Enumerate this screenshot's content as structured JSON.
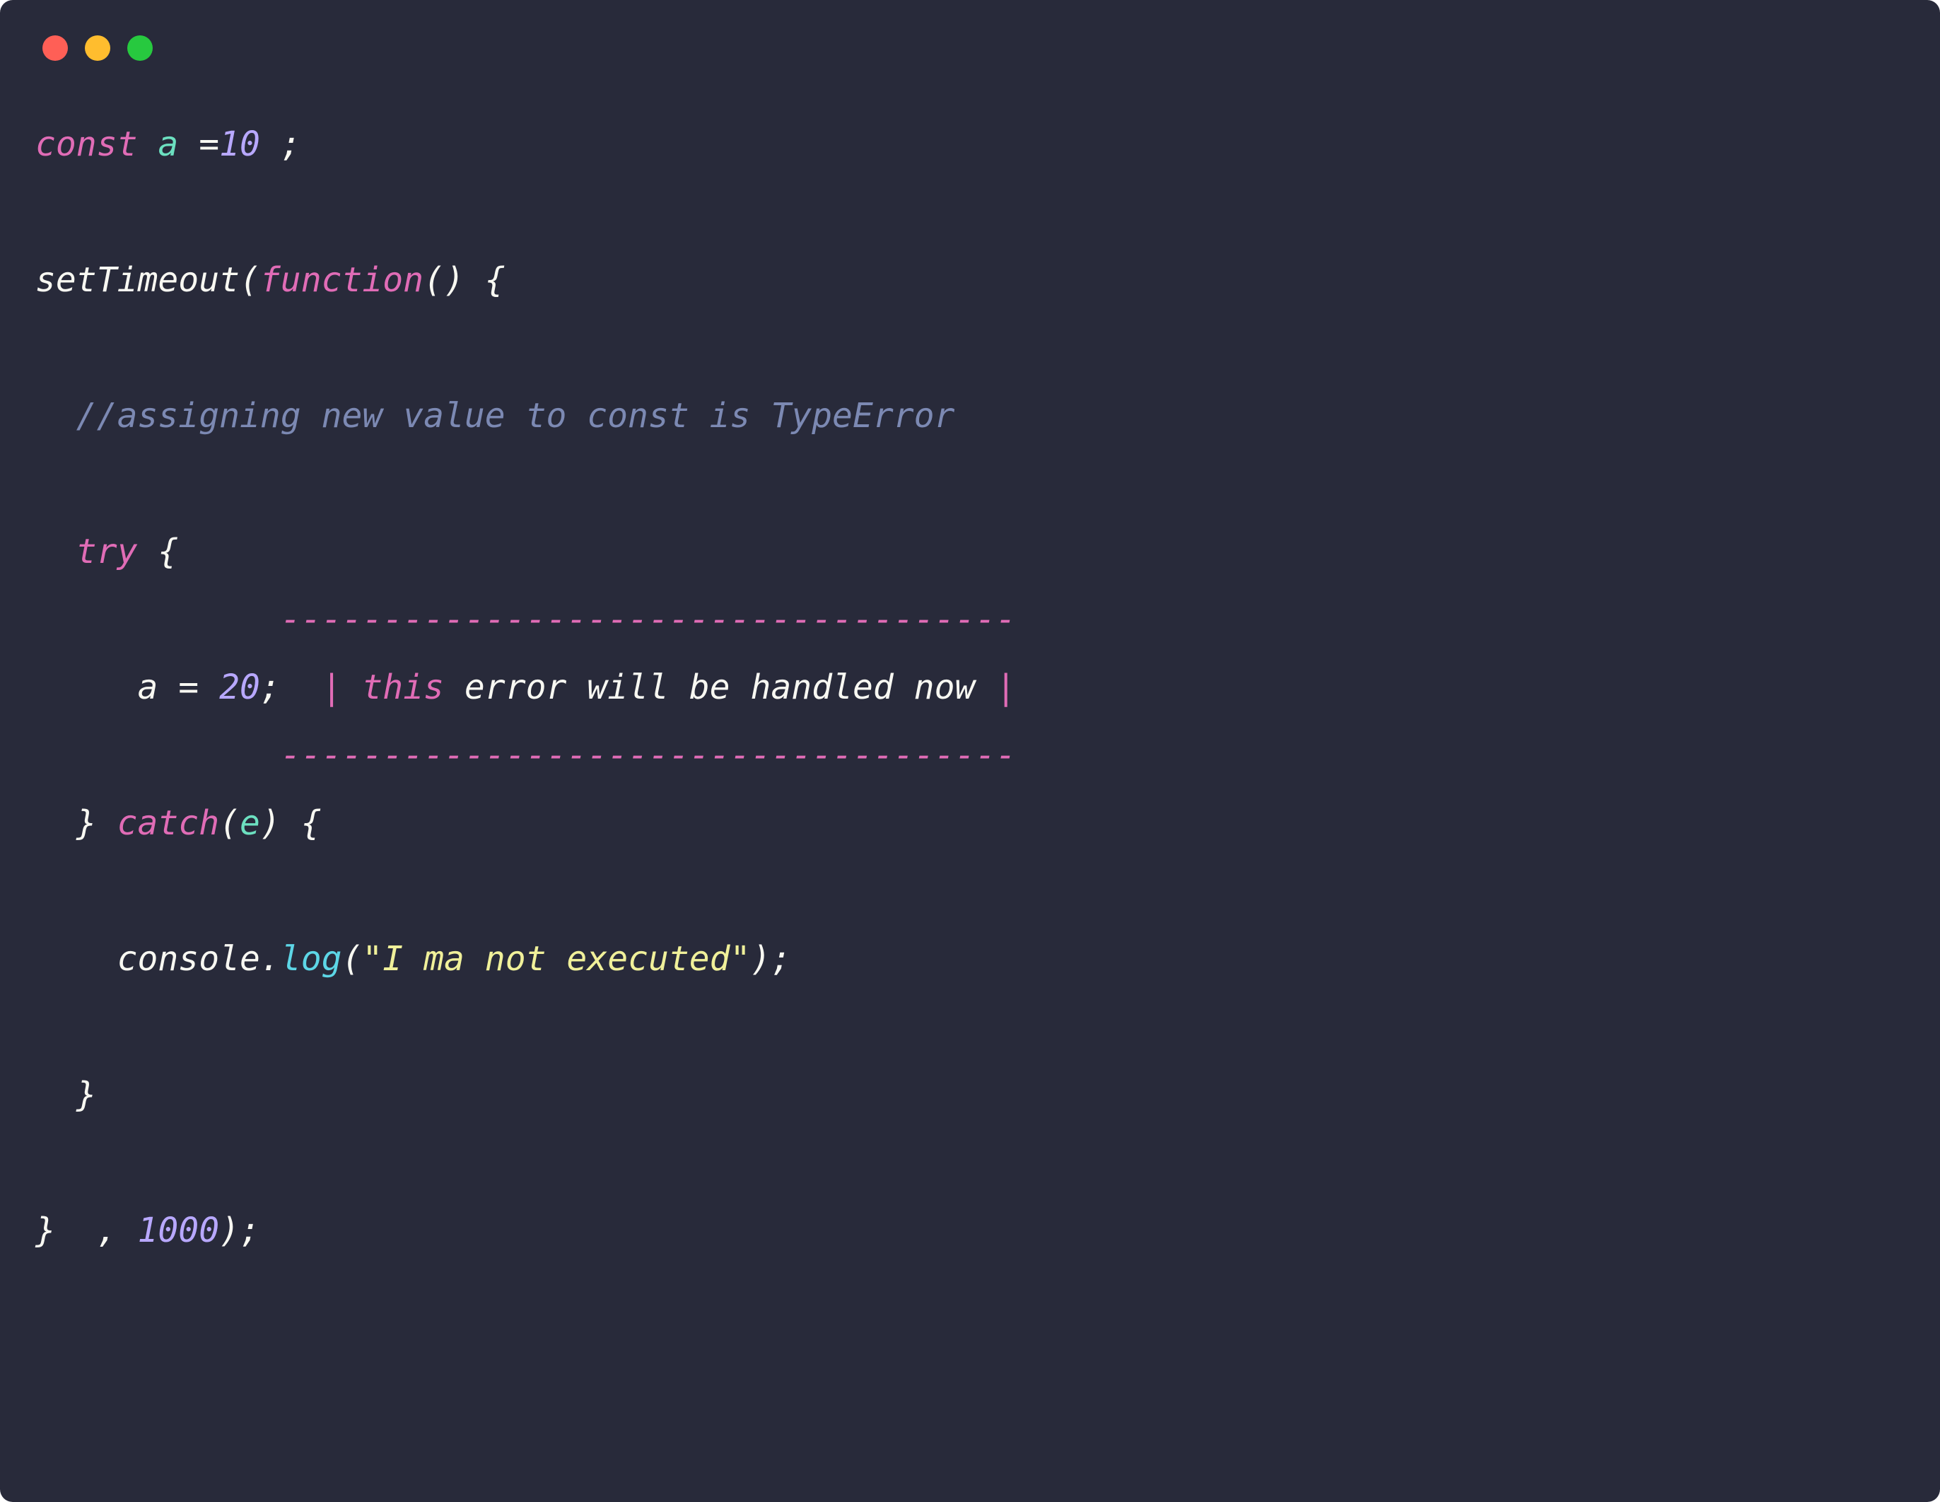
{
  "code": {
    "line1": {
      "const": "const",
      "var": "a",
      "eq": "=",
      "val": "10",
      "semi": " ;"
    },
    "line3": {
      "fn": "setTimeout",
      "paren1": "(",
      "kw": "function",
      "parens": "()",
      "brace": " {"
    },
    "line5": {
      "comment": "//assigning new value to const is TypeError"
    },
    "line7": {
      "try": "try",
      "brace": " {"
    },
    "line8": {
      "dashes": "------------------------------------"
    },
    "line9": {
      "var": "a",
      "eq": " = ",
      "val": "20",
      "semi": ";  ",
      "pipe1": "| ",
      "this": "this",
      "text": " error will be handled now ",
      "pipe2": "|"
    },
    "line10": {
      "dashes": "------------------------------------"
    },
    "line11": {
      "brace1": "} ",
      "catch": "catch",
      "paren1": "(",
      "e": "e",
      "paren2": ")",
      "brace2": " {"
    },
    "line13": {
      "console": "console",
      "dot": ".",
      "log": "log",
      "paren1": "(",
      "str": "\"I ma not executed\"",
      "paren2": ");"
    },
    "line15": {
      "brace": "}"
    },
    "line17": {
      "brace": "} ",
      "comma": " , ",
      "val": "1000",
      "paren": ");"
    }
  }
}
